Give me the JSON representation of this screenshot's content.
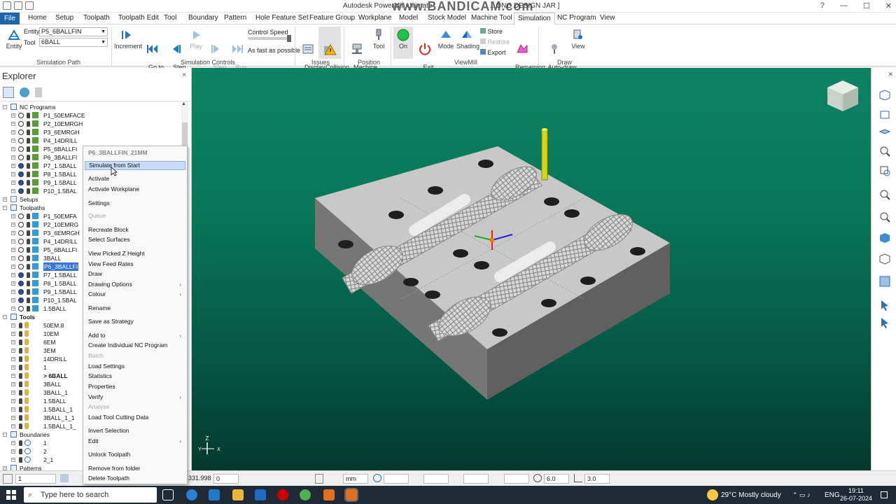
{
  "window": {
    "title": "Autodesk PowerMill Ultimate",
    "watermark": "www.BANDICAM.com",
    "title_suffix": "...ONG DESIGN JAR ]",
    "controls": [
      "?",
      "—",
      "☐",
      "✕"
    ]
  },
  "tabs": [
    "File",
    "Home",
    "Setup",
    "Toolpath",
    "Toolpath Edit",
    "Tool",
    "Boundary",
    "Pattern",
    "Hole Feature Set",
    "Feature Group",
    "Workplane",
    "Model",
    "Stock Model",
    "Machine Tool",
    "Simulation",
    "NC Program",
    "View"
  ],
  "ribbon": {
    "entity_label": "Entity",
    "entity_caption": "Entity",
    "entity_field_label": "Entity",
    "entity_value": "P5_6BALLFIN",
    "tool_label": "Tool",
    "tool_value": "6BALL",
    "sim_path_group": "Simulation Path",
    "increment": "Increment",
    "go_beginning": "Go to\nBeginning",
    "step_back": "Step\nBack",
    "play": "Play",
    "step_forward": "Step\nForward",
    "run_to_end": "Run\nto End",
    "control_speed": "Control Speed",
    "speed_value": "As fast as possible",
    "sim_controls_group": "Simulation Controls",
    "display_issues": "Display\nIssues",
    "collision_check": "Collision\nCheck",
    "issues_group": "Issues",
    "machine_tool": "Machine\nTool",
    "tool": "Tool",
    "position_group": "Position",
    "on": "On",
    "exit_viewmill": "Exit\nViewMill",
    "mode": "Mode",
    "shading": "Shading",
    "store": "Store",
    "restore": "Restore",
    "export": "Export",
    "remaining_material": "Remaining\nMaterial",
    "viewmill_group": "ViewMill",
    "auto_draw_tool": "Auto-draw\ntool",
    "view": "View",
    "draw_group": "Draw"
  },
  "explorer": {
    "title": "Explorer",
    "close": "×",
    "rows": [
      {
        "label": "NC Programs",
        "level": 0,
        "kind": "folder",
        "exp": "−"
      },
      {
        "label": "P1_50EMFACE",
        "level": 1,
        "kind": "nc"
      },
      {
        "label": "P2_10EMRGH",
        "level": 1,
        "kind": "nc"
      },
      {
        "label": "P3_6EMRGH",
        "level": 1,
        "kind": "nc"
      },
      {
        "label": "P4_14DRILL",
        "level": 1,
        "kind": "nc"
      },
      {
        "label": "P5_6BALLFI",
        "level": 1,
        "kind": "nc"
      },
      {
        "label": "P6_3BALLFI",
        "level": 1,
        "kind": "nc"
      },
      {
        "label": "P7_1.5BALL",
        "level": 1,
        "kind": "nc2"
      },
      {
        "label": "P8_1.5BALL",
        "level": 1,
        "kind": "nc2"
      },
      {
        "label": "P9_1.5BALL",
        "level": 1,
        "kind": "nc2"
      },
      {
        "label": "P10_1.5BAL",
        "level": 1,
        "kind": "nc2"
      },
      {
        "label": "Setups",
        "level": 0,
        "kind": "setup",
        "exp": "+"
      },
      {
        "label": "Toolpaths",
        "level": 0,
        "kind": "folder",
        "exp": "−"
      },
      {
        "label": "P1_50EMFA",
        "level": 1,
        "kind": "tp"
      },
      {
        "label": "P2_10EMRG",
        "level": 1,
        "kind": "tp"
      },
      {
        "label": "P3_6EMRGH",
        "level": 1,
        "kind": "tp"
      },
      {
        "label": "P4_14DRILL",
        "level": 1,
        "kind": "tp"
      },
      {
        "label": "P5_6BALLFI",
        "level": 1,
        "kind": "tp"
      },
      {
        "label": "3BALL",
        "level": 1,
        "kind": "tp"
      },
      {
        "label": "P6_3BALLFI",
        "level": 1,
        "kind": "tp",
        "highlight": true
      },
      {
        "label": "P7_1.5BALL",
        "level": 1,
        "kind": "tp2"
      },
      {
        "label": "P8_1.5BALL",
        "level": 1,
        "kind": "tp2"
      },
      {
        "label": "P9_1.5BALL",
        "level": 1,
        "kind": "tp2"
      },
      {
        "label": "P10_1.5BAL",
        "level": 1,
        "kind": "tp2"
      },
      {
        "label": "1.5BALL",
        "level": 1,
        "kind": "tp"
      },
      {
        "label": "Tools",
        "level": 0,
        "kind": "folder",
        "exp": "−",
        "bold": true
      },
      {
        "label": "50EM.8",
        "level": 1,
        "kind": "tool"
      },
      {
        "label": "10EM",
        "level": 1,
        "kind": "tool"
      },
      {
        "label": "6EM",
        "level": 1,
        "kind": "tool"
      },
      {
        "label": "3EM",
        "level": 1,
        "kind": "tool"
      },
      {
        "label": "14DRILL",
        "level": 1,
        "kind": "tool"
      },
      {
        "label": "1",
        "level": 1,
        "kind": "tool"
      },
      {
        "label": "> 6BALL",
        "level": 1,
        "kind": "tool",
        "bold": true
      },
      {
        "label": "3BALL",
        "level": 1,
        "kind": "tool"
      },
      {
        "label": "3BALL_1",
        "level": 1,
        "kind": "tool"
      },
      {
        "label": "1.5BALL",
        "level": 1,
        "kind": "tool"
      },
      {
        "label": "1.5BALL_1",
        "level": 1,
        "kind": "tool"
      },
      {
        "label": "3BALL_1_1",
        "level": 1,
        "kind": "tool"
      },
      {
        "label": "1.5BALL_1_",
        "level": 1,
        "kind": "tool"
      },
      {
        "label": "Boundaries",
        "level": 0,
        "kind": "folder",
        "exp": "−"
      },
      {
        "label": "1",
        "level": 1,
        "kind": "bnd"
      },
      {
        "label": "2",
        "level": 1,
        "kind": "bnd"
      },
      {
        "label": "2_1",
        "level": 1,
        "kind": "bnd"
      },
      {
        "label": "Patterns",
        "level": 0,
        "kind": "folder",
        "exp": "+"
      }
    ]
  },
  "context_menu": {
    "header": "P6_3BALLFIN_21MM",
    "items": [
      {
        "label": "Simulate from Start",
        "state": "hover"
      },
      {
        "label": "Activate"
      },
      {
        "label": "Activate Workplane"
      },
      {
        "label": "Settings"
      },
      {
        "label": "Queue",
        "state": "disabled"
      },
      {
        "label": "Recreate Block"
      },
      {
        "label": "Select Surfaces"
      },
      {
        "label": "View Picked Z Height"
      },
      {
        "label": "View Feed Rates"
      },
      {
        "label": "Draw"
      },
      {
        "label": "Drawing Options",
        "submenu": true
      },
      {
        "label": "Colour",
        "submenu": true
      },
      {
        "label": "Rename"
      },
      {
        "label": "Save as Strategy"
      },
      {
        "label": "Add to",
        "submenu": true
      },
      {
        "label": "Create Individual NC Program"
      },
      {
        "label": "Batch",
        "state": "disabled"
      },
      {
        "label": "Load Settings"
      },
      {
        "label": "Statistics"
      },
      {
        "label": "Properties"
      },
      {
        "label": "Verify",
        "submenu": true
      },
      {
        "label": "Analyse",
        "state": "disabled"
      },
      {
        "label": "Load Tool Cutting Data"
      },
      {
        "label": "Invert Selection"
      },
      {
        "label": "Edit",
        "submenu": true
      },
      {
        "label": "Unlock Toolpath"
      },
      {
        "label": "Remove from folder"
      },
      {
        "label": "Delete Toolpath"
      }
    ]
  },
  "status": {
    "field_left": "1",
    "coord_x": "331.998",
    "coord_y": "0",
    "units": "mm",
    "tol1": "6.0",
    "tol2": "3.0"
  },
  "axis_triad": {
    "z": "Z",
    "y": "Y",
    "x": "X"
  },
  "taskbar": {
    "search": "Type here to search",
    "weather": "29°C  Mostly cloudy",
    "lang": "ENG",
    "time": "19:11",
    "date": "26-07-2024"
  },
  "colors": {
    "accent": "#1e64aa",
    "viewport_top": "#0b8363",
    "viewport_bottom": "#03392c",
    "block": "#c9c9c9",
    "highlight": "#3875d7"
  }
}
